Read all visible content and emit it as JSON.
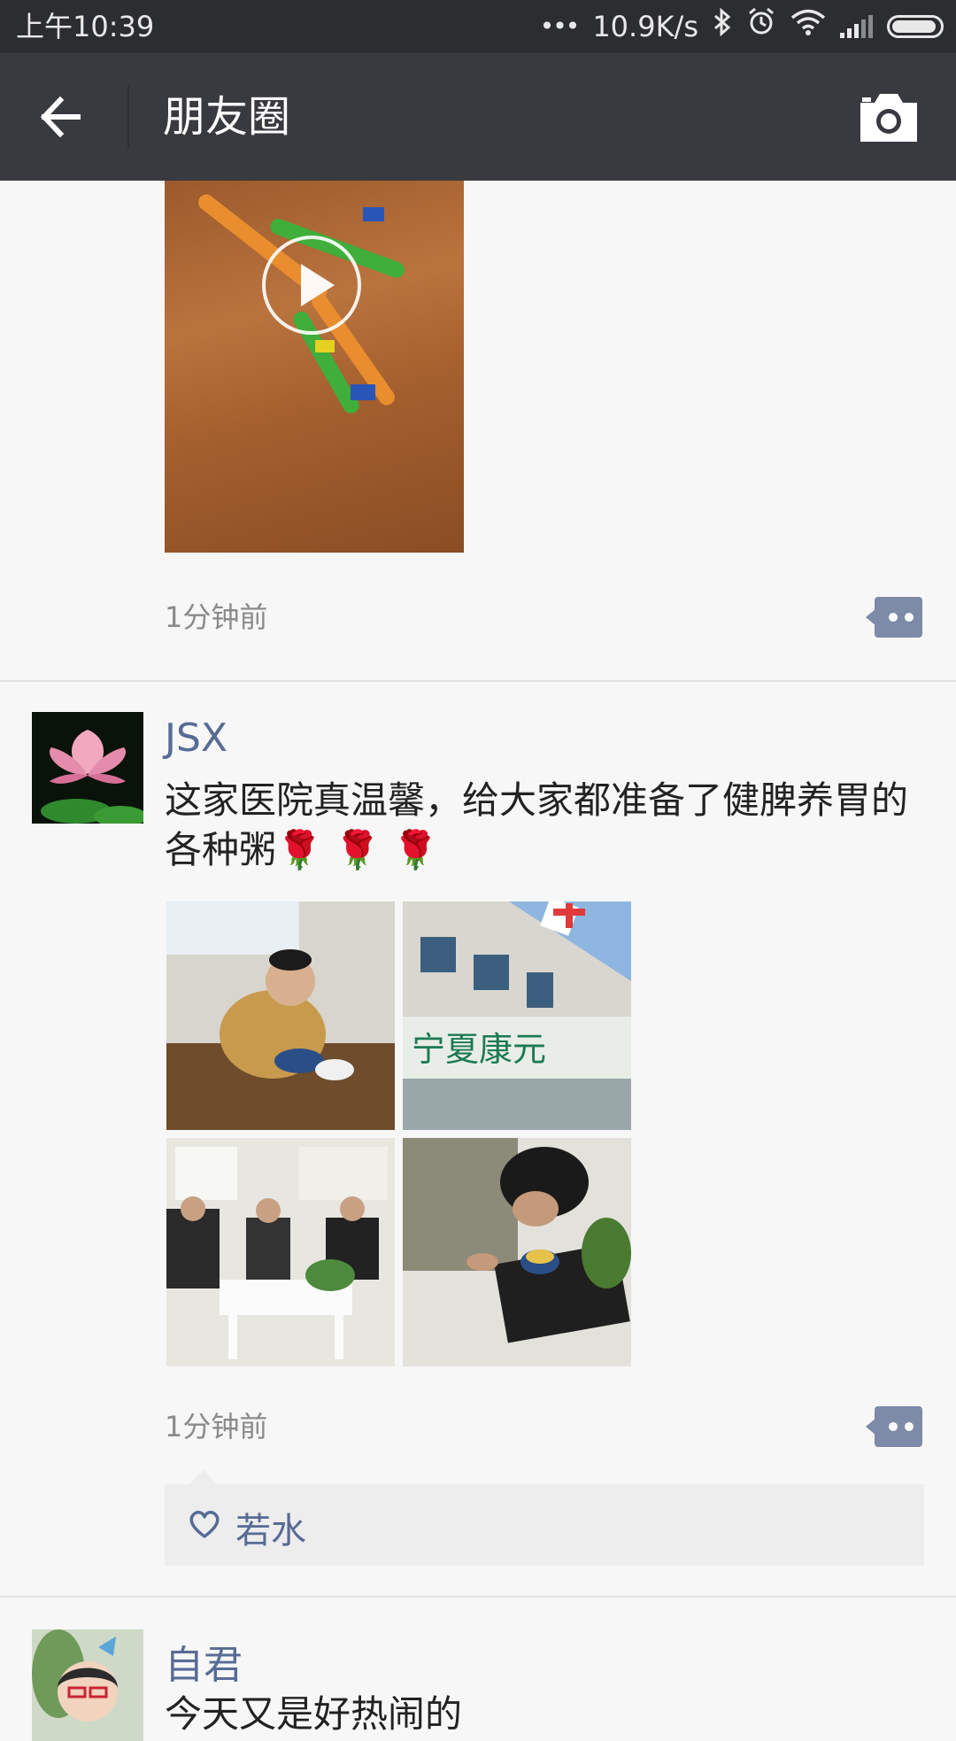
{
  "status_bar": {
    "time": "上午10:39",
    "dots": "•••",
    "network_speed": "10.9K/s",
    "icons": [
      "bluetooth-icon",
      "alarm-icon",
      "wifi-icon",
      "signal-icon",
      "battery-icon"
    ]
  },
  "header": {
    "title": "朋友圈",
    "back_icon": "back-arrow-icon",
    "camera_icon": "camera-icon"
  },
  "posts": [
    {
      "media": "video",
      "time": "1分钟前"
    },
    {
      "username": "JSX",
      "text": "这家医院真温馨，给大家都准备了健脾养胃的各种粥🌹 🌹 🌹",
      "photo_count": 4,
      "time": "1分钟前",
      "likes": [
        "若水"
      ]
    },
    {
      "username": "自君",
      "text": "今天又是好热闹的"
    }
  ],
  "colors": {
    "header_bg": "#393a3f",
    "status_bg": "#2b2d31",
    "link_blue": "#576b95",
    "page_bg": "#f7f7f7"
  }
}
